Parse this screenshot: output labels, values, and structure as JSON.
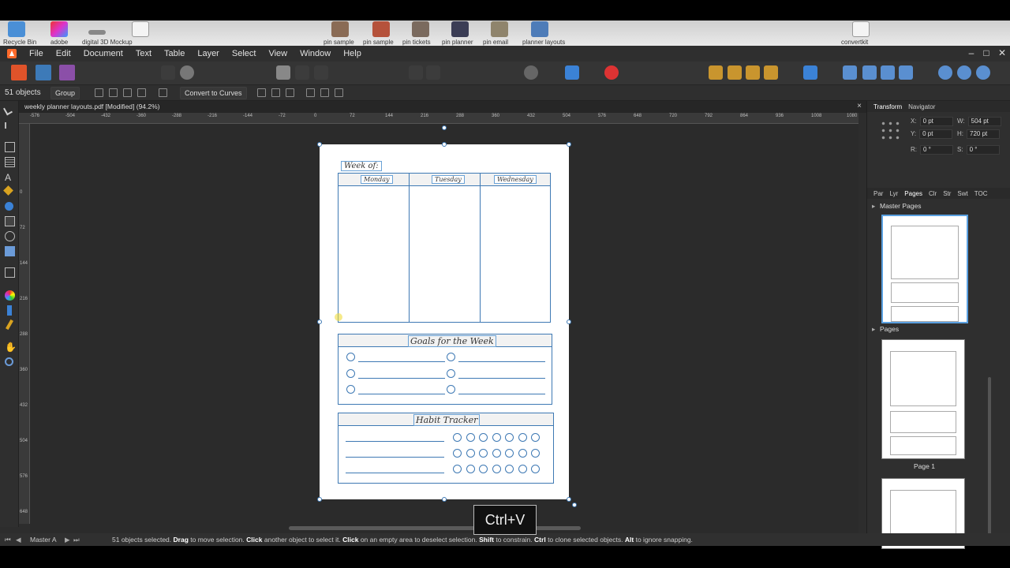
{
  "desktop": {
    "labels": [
      "Recycle Bin",
      "adobe",
      "digital 3D Mockup",
      "pin sample",
      "pin sample",
      "pin tickets",
      "pin planner",
      "pin email",
      "planner layouts",
      "convertkit"
    ]
  },
  "menu": [
    "File",
    "Edit",
    "Document",
    "Text",
    "Table",
    "Layer",
    "Select",
    "View",
    "Window",
    "Help"
  ],
  "context": {
    "objects": "51 objects",
    "group": "Group",
    "convert": "Convert to Curves"
  },
  "document": {
    "tab_title": "weekly planner layouts.pdf [Modified] (94.2%)",
    "close": "×"
  },
  "ruler": {
    "h_ticks": [
      "-576",
      "-504",
      "-432",
      "-360",
      "-288",
      "-216",
      "-144",
      "-72",
      "0",
      "72",
      "144",
      "216",
      "288",
      "360",
      "432",
      "504",
      "576",
      "648",
      "720",
      "792",
      "864",
      "936",
      "1008",
      "1080"
    ],
    "v_ticks": [
      "0",
      "72",
      "144",
      "216",
      "288",
      "360",
      "432",
      "504",
      "576",
      "648",
      "720"
    ]
  },
  "planner": {
    "week_of": "Week of:",
    "days": [
      "Monday",
      "Tuesday",
      "Wednesday"
    ],
    "goals_title": "Goals for the Week",
    "habit_title": "Habit Tracker"
  },
  "panel": {
    "tabs": [
      "Transform",
      "Navigator"
    ],
    "x_label": "X:",
    "x_val": "0 pt",
    "y_label": "Y:",
    "y_val": "0 pt",
    "w_label": "W:",
    "w_val": "504 pt",
    "h_label": "H:",
    "h_val": "720 pt",
    "r_label": "R:",
    "r_val": "0 °",
    "s_label": "S:",
    "s_val": "0 °",
    "sub_tabs": [
      "Par",
      "Lyr",
      "Pages",
      "Clr",
      "Str",
      "Swt",
      "TOC"
    ],
    "master_pages": "Master Pages",
    "pages": "Pages",
    "page1": "Page 1"
  },
  "status": {
    "master": "Master A",
    "message_prefix": "51 objects selected.",
    "drag": "Drag",
    "drag_t": "to move selection.",
    "click": "Click",
    "click_t": "another object to select it.",
    "click2": "Click",
    "click2_t": "on an empty area to deselect selection.",
    "shift": "Shift",
    "shift_t": "to constrain.",
    "ctrl": "Ctrl",
    "ctrl_t": "to clone selected objects.",
    "alt": "Alt",
    "alt_t": "to ignore snapping."
  },
  "overlay": {
    "shortcut": "Ctrl+V"
  },
  "colors": {
    "accent": "#3e79b4",
    "brand": "#ff6a2b"
  }
}
